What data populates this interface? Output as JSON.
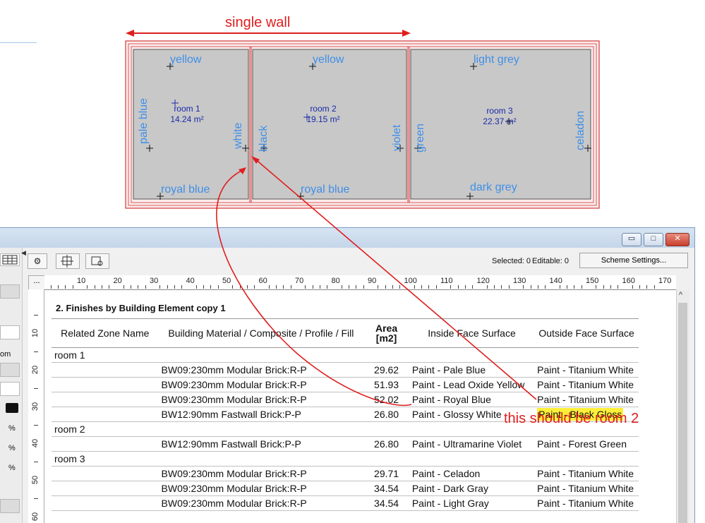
{
  "annotations": {
    "single_wall": "single wall",
    "note": "this should be room 2"
  },
  "plan": {
    "rooms": [
      {
        "name": "room 1",
        "area": "14.24 m²",
        "labels": {
          "top": "yellow",
          "left": "pale blue",
          "right": "white",
          "bottom": "royal blue"
        }
      },
      {
        "name": "room 2",
        "area": "19.15 m²",
        "labels": {
          "top": "yellow",
          "left": "black",
          "right": "violet",
          "bottom": "royal blue"
        }
      },
      {
        "name": "room 3",
        "area": "22.37 m²",
        "labels": {
          "top": "light grey",
          "left": "green",
          "right": "celadon",
          "bottom": "dark grey"
        }
      }
    ]
  },
  "window": {
    "controls": {
      "minimize": "▭",
      "maximize": "□",
      "close": "✕"
    },
    "toolbar": {
      "selected": "Selected: 0",
      "editable": "Editable: 0",
      "scheme_settings": "Scheme Settings...",
      "more": "..."
    },
    "toolbar_icons": [
      "gear-icon",
      "zone-icon",
      "zone-tool-icon"
    ],
    "sidebar_units": [
      "%",
      "%",
      "%"
    ],
    "sidebar_text": "om"
  },
  "ruler": {
    "h_ticks": [
      "10",
      "20",
      "30",
      "40",
      "50",
      "60",
      "70",
      "80",
      "90",
      "100",
      "110",
      "120",
      "130",
      "140",
      "150",
      "160",
      "170"
    ],
    "v_ticks": [
      "10",
      "20",
      "30",
      "40",
      "50",
      "60"
    ]
  },
  "schedule": {
    "title": "2. Finishes by Building Element copy 1",
    "headers": [
      "Related Zone Name",
      "Building Material / Composite / Profile / Fill",
      "Area\n[m2]",
      "Inside Face Surface",
      "Outside Face Surface"
    ],
    "groups": [
      {
        "zone": "room 1",
        "rows": [
          {
            "material": "BW09:230mm Modular Brick:R-P",
            "area": "29.62",
            "inside": "Paint - Pale Blue",
            "outside": "Paint - Titanium White",
            "highlight": false
          },
          {
            "material": "BW09:230mm Modular Brick:R-P",
            "area": "51.93",
            "inside": "Paint - Lead Oxide Yellow",
            "outside": "Paint - Titanium White",
            "highlight": false
          },
          {
            "material": "BW09:230mm Modular Brick:R-P",
            "area": "52.02",
            "inside": "Paint - Royal Blue",
            "outside": "Paint - Titanium White",
            "highlight": false
          },
          {
            "material": "BW12:90mm Fastwall Brick:P-P",
            "area": "26.80",
            "inside": "Paint - Glossy White",
            "outside": "Paint - Black Gloss",
            "highlight": true
          }
        ]
      },
      {
        "zone": "room 2",
        "rows": [
          {
            "material": "BW12:90mm Fastwall Brick:P-P",
            "area": "26.80",
            "inside": "Paint - Ultramarine Violet",
            "outside": "Paint - Forest Green",
            "highlight": false
          }
        ]
      },
      {
        "zone": "room 3",
        "rows": [
          {
            "material": "BW09:230mm Modular Brick:R-P",
            "area": "29.71",
            "inside": "Paint - Celadon",
            "outside": "Paint - Titanium White",
            "highlight": false
          },
          {
            "material": "BW09:230mm Modular Brick:R-P",
            "area": "34.54",
            "inside": "Paint - Dark Gray",
            "outside": "Paint - Titanium White",
            "highlight": false
          },
          {
            "material": "BW09:230mm Modular Brick:R-P",
            "area": "34.54",
            "inside": "Paint - Light Gray",
            "outside": "Paint - Titanium White",
            "highlight": false
          }
        ]
      }
    ]
  },
  "colors": {
    "annotation": "#e01e1e",
    "label_blue": "#3f8fe8",
    "room_text": "#1b2aa8",
    "highlight": "#ffef3a",
    "wall": "#d23a3a",
    "room_fill": "#c8c8c8"
  }
}
